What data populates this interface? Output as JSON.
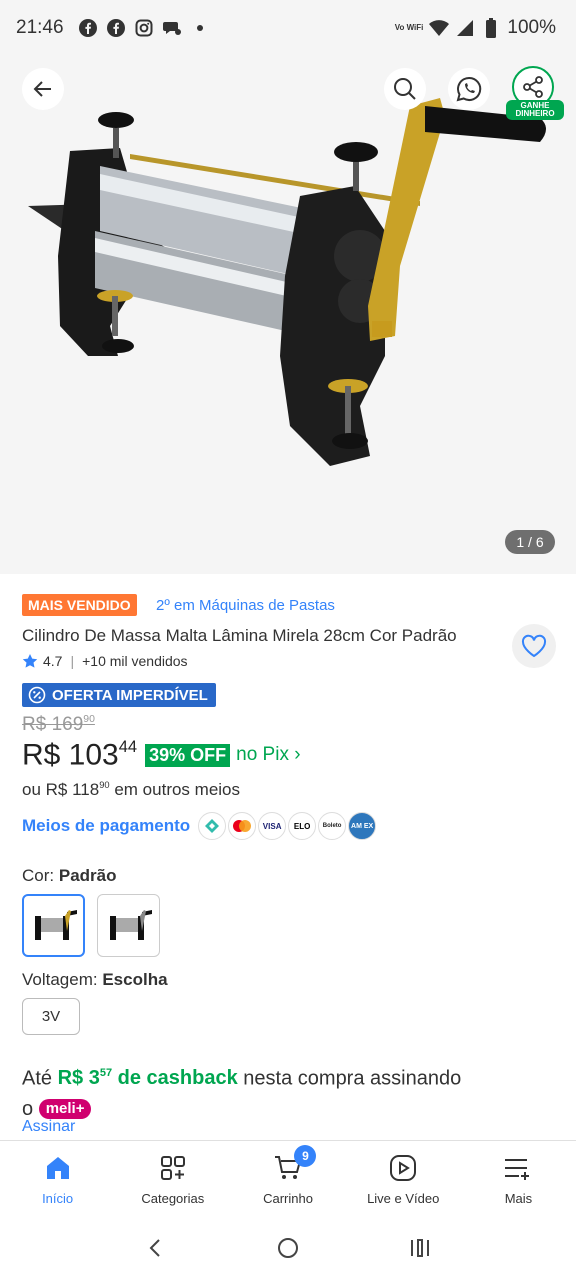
{
  "status_bar": {
    "time": "21:46",
    "wifi_label": "Vo WiFi",
    "battery": "100%"
  },
  "hero": {
    "image_counter": "1 / 6",
    "share_badge": "GANHE DINHEIRO"
  },
  "product": {
    "best_seller_badge": "MAIS VENDIDO",
    "ranking": "2º em Máquinas de Pastas",
    "title": "Cilindro De Massa Malta Lâmina Mirela 28cm Cor Padrão",
    "rating": "4.7",
    "sold": "+10 mil vendidos",
    "offer_badge": "OFERTA IMPERDÍVEL",
    "old_price_int": "R$ 169",
    "old_price_cents": "90",
    "price_int": "R$ 103",
    "price_cents": "44",
    "discount": "39% OFF",
    "pix_link": "no Pix ›",
    "other_prefix": "ou R$ 118",
    "other_cents": "90",
    "other_suffix": "em outros meios",
    "payment_link": "Meios de pagamento",
    "payment_icons": [
      "pix-icon",
      "mastercard-icon",
      "visa-icon",
      "elo-icon",
      "boleto-icon",
      "amex-icon"
    ],
    "payment_icon_labels": {
      "visa": "VISA",
      "elo": "ELO",
      "boleto": "Boleto",
      "amex": "AM EX"
    }
  },
  "variants": {
    "color_label": "Cor:",
    "color_value": "Padrão",
    "voltage_label": "Voltagem:",
    "voltage_value": "Escolha",
    "voltage_option": "3V"
  },
  "cashback": {
    "prefix": "Até",
    "amount_int": "R$ 3",
    "amount_cents": "57",
    "green_suffix": "de cashback",
    "suffix": "nesta compra assinando o",
    "badge": "meli+",
    "subscribe_link": "Assinar"
  },
  "bottom_nav": {
    "items": [
      {
        "label": "Início",
        "icon": "home-icon",
        "active": true
      },
      {
        "label": "Categorias",
        "icon": "categories-icon"
      },
      {
        "label": "Carrinho",
        "icon": "cart-icon"
      },
      {
        "label": "Live e Vídeo",
        "icon": "live-video-icon"
      },
      {
        "label": "Mais",
        "icon": "more-icon"
      }
    ],
    "cart_count": "9"
  },
  "colors": {
    "accent": "#3483fa",
    "green": "#00a650",
    "orange": "#ff7733",
    "meli_pink": "#d0006f"
  }
}
